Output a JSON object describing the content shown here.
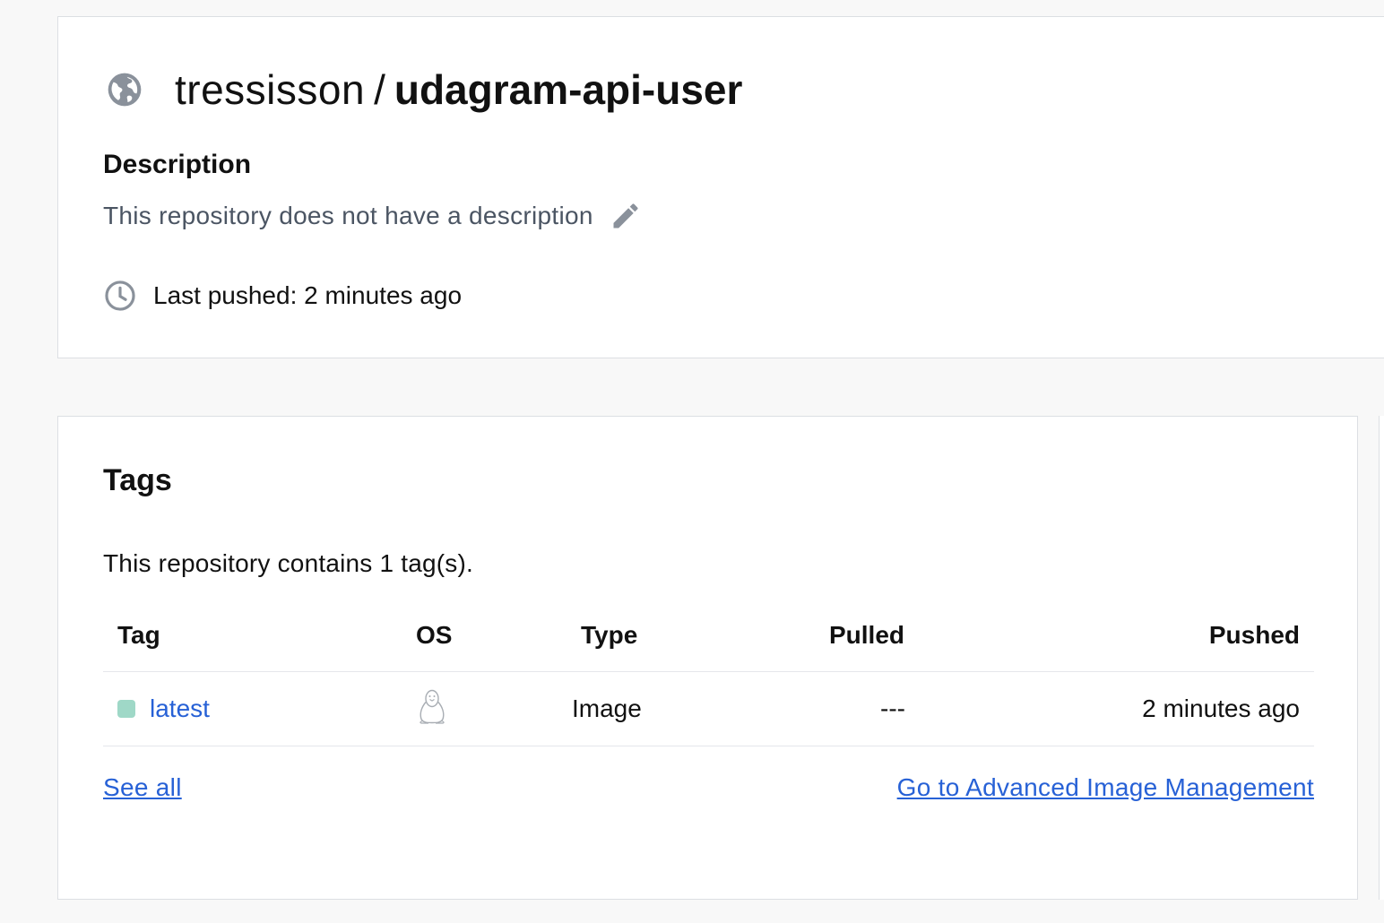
{
  "repo": {
    "namespace": "tressisson",
    "separator": "/",
    "name": "udagram-api-user",
    "visibility_icon": "globe-icon"
  },
  "description": {
    "heading": "Description",
    "text": "This repository does not have a description",
    "edit_icon": "pencil-icon"
  },
  "last_pushed": {
    "text": "Last pushed: 2 minutes ago",
    "icon": "clock-icon"
  },
  "tags": {
    "title": "Tags",
    "summary": "This repository contains 1 tag(s).",
    "columns": {
      "tag": "Tag",
      "os": "OS",
      "type": "Type",
      "pulled": "Pulled",
      "pushed": "Pushed"
    },
    "rows": [
      {
        "status_color": "#9fd8c7",
        "tag": "latest",
        "os_icon": "linux-penguin-icon",
        "type": "Image",
        "pulled": "---",
        "pushed": "2 minutes ago"
      }
    ],
    "see_all": "See all",
    "advanced": "Go to Advanced Image Management"
  },
  "colors": {
    "link": "#2761d6",
    "status_active": "#9fd8c7",
    "icon_gray": "#8a919b"
  }
}
